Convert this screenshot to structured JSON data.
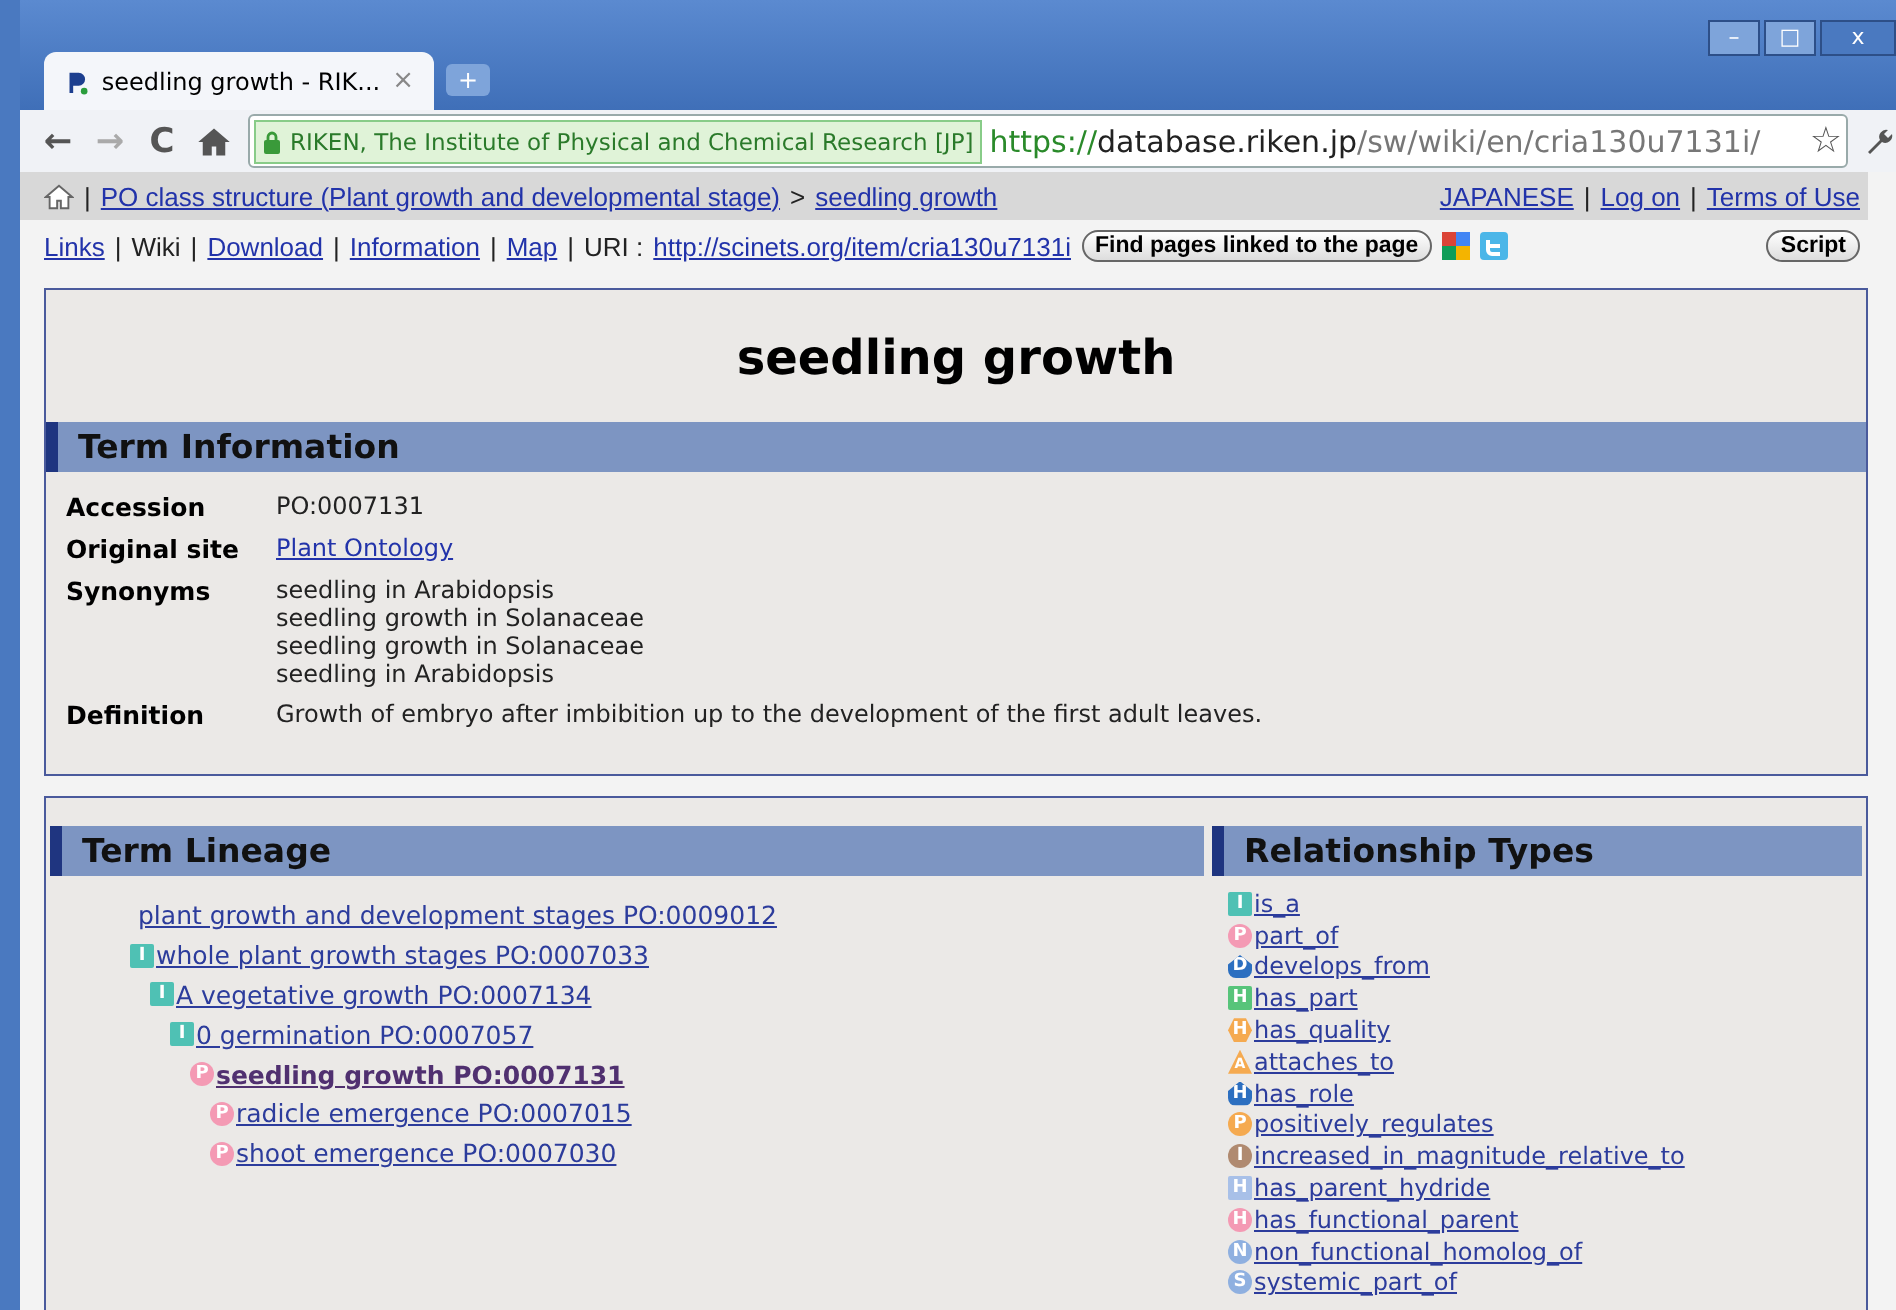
{
  "window": {
    "tab_title": "seedling growth - RIK...",
    "tab_close": "×",
    "new_tab": "+",
    "minimize": "–",
    "maximize": "□",
    "close": "x"
  },
  "toolbar": {
    "back": "←",
    "forward": "→",
    "reload": "C",
    "security_label": "RIKEN, The Institute of Physical and Chemical Research [JP]",
    "url_scheme": "https://",
    "url_host": "database.riken.jp",
    "url_path": "/sw/wiki/en/cria130u7131i/",
    "star": "☆"
  },
  "breadcrumb": {
    "items": [
      {
        "kind": "separator",
        "label": "|"
      },
      {
        "kind": "link",
        "label": "PO class structure (Plant growth and developmental stage)"
      },
      {
        "kind": "text",
        "label": ">"
      },
      {
        "kind": "link",
        "label": "seedling growth"
      }
    ],
    "right_links": [
      {
        "kind": "link",
        "label": "JAPANESE"
      },
      {
        "kind": "separator",
        "label": "|"
      },
      {
        "kind": "link",
        "label": "Log on"
      },
      {
        "kind": "separator",
        "label": "|"
      },
      {
        "kind": "link",
        "label": "Terms of Use"
      }
    ]
  },
  "nav": {
    "items": [
      {
        "kind": "link",
        "label": "Links"
      },
      {
        "kind": "separator",
        "label": "|"
      },
      {
        "kind": "text",
        "label": "Wiki"
      },
      {
        "kind": "separator",
        "label": "|"
      },
      {
        "kind": "link",
        "label": "Download"
      },
      {
        "kind": "separator",
        "label": "|"
      },
      {
        "kind": "link",
        "label": "Information"
      },
      {
        "kind": "separator",
        "label": "|"
      },
      {
        "kind": "link",
        "label": "Map"
      },
      {
        "kind": "separator",
        "label": "|"
      },
      {
        "kind": "text",
        "label": "URI :"
      }
    ],
    "uri": "http://scinets.org/item/cria130u7131i",
    "find_button": "Find pages linked to the page",
    "script_button": "Script"
  },
  "page_title": "seedling growth",
  "term_information": {
    "heading": "Term Information",
    "rows": [
      {
        "label": "Accession",
        "kind": "text",
        "values": [
          "PO:0007131"
        ]
      },
      {
        "label": "Original site",
        "kind": "link",
        "values": [
          "Plant Ontology"
        ]
      },
      {
        "label": "Synonyms",
        "kind": "text",
        "values": [
          "seedling in Arabidopsis",
          "seedling growth in Solanaceae",
          "seedling growth in Solanaceae",
          "seedling in Arabidopsis"
        ]
      },
      {
        "label": "Definition",
        "kind": "text",
        "values": [
          "Growth of embryo after imbibition up to the development of the first adult leaves."
        ]
      }
    ]
  },
  "term_lineage": {
    "heading": "Term Lineage",
    "tree": [
      {
        "label": "plant growth and development stages PO:0009012",
        "selected": false,
        "children": [
          {
            "label": "whole plant growth stages PO:0007033",
            "selected": false,
            "badge": {
              "kind": "square",
              "letter": "I",
              "color": "#4fc1b4"
            },
            "children": [
              {
                "label": "A vegetative growth PO:0007134",
                "selected": false,
                "badge": {
                  "kind": "square",
                  "letter": "I",
                  "color": "#4fc1b4"
                },
                "children": [
                  {
                    "label": "0 germination PO:0007057",
                    "selected": false,
                    "badge": {
                      "kind": "square",
                      "letter": "I",
                      "color": "#4fc1b4"
                    },
                    "children": [
                      {
                        "label": "seedling growth PO:0007131",
                        "selected": true,
                        "badge": {
                          "kind": "circle",
                          "letter": "P",
                          "color": "#f49ab4"
                        },
                        "children": [
                          {
                            "label": "radicle emergence PO:0007015",
                            "selected": false,
                            "badge": {
                              "kind": "circle",
                              "letter": "P",
                              "color": "#f49ab4"
                            }
                          },
                          {
                            "label": "shoot emergence PO:0007030",
                            "selected": false,
                            "badge": {
                              "kind": "circle",
                              "letter": "P",
                              "color": "#f49ab4"
                            }
                          }
                        ]
                      }
                    ]
                  }
                ]
              }
            ]
          }
        ]
      }
    ]
  },
  "relationship_types": {
    "heading": "Relationship Types",
    "items": [
      {
        "label": "is_a",
        "badge": {
          "kind": "square",
          "letter": "I",
          "color": "#4fc1b4"
        }
      },
      {
        "label": "part_of",
        "badge": {
          "kind": "circle",
          "letter": "P",
          "color": "#f49ab4"
        }
      },
      {
        "label": "develops_from",
        "badge": {
          "kind": "pentagon",
          "letter": "D",
          "color": "#2c6fc0"
        }
      },
      {
        "label": "has_part",
        "badge": {
          "kind": "square",
          "letter": "H",
          "color": "#57c47a"
        }
      },
      {
        "label": "has_quality",
        "badge": {
          "kind": "hexagon",
          "letter": "H",
          "color": "#f5aa50"
        }
      },
      {
        "label": "attaches_to",
        "badge": {
          "kind": "triangle",
          "letter": "A",
          "color": "#f5aa50"
        }
      },
      {
        "label": "has_role",
        "badge": {
          "kind": "pentagon",
          "letter": "H",
          "color": "#2c6fc0"
        }
      },
      {
        "label": "positively_regulates",
        "badge": {
          "kind": "circle",
          "letter": "P",
          "color": "#f5aa50"
        }
      },
      {
        "label": "increased_in_magnitude_relative_to",
        "badge": {
          "kind": "circle",
          "letter": "I",
          "color": "#b08a70"
        }
      },
      {
        "label": "has_parent_hydride",
        "badge": {
          "kind": "square",
          "letter": "H",
          "color": "#a8c0e8"
        }
      },
      {
        "label": "has_functional_parent",
        "badge": {
          "kind": "circle",
          "letter": "H",
          "color": "#f49ab4"
        }
      },
      {
        "label": "non_functional_homolog_of",
        "badge": {
          "kind": "circle",
          "letter": "N",
          "color": "#8fb0e0"
        }
      },
      {
        "label": "systemic_part_of",
        "badge": {
          "kind": "circle",
          "letter": "S",
          "color": "#8fb0e0"
        }
      }
    ]
  }
}
